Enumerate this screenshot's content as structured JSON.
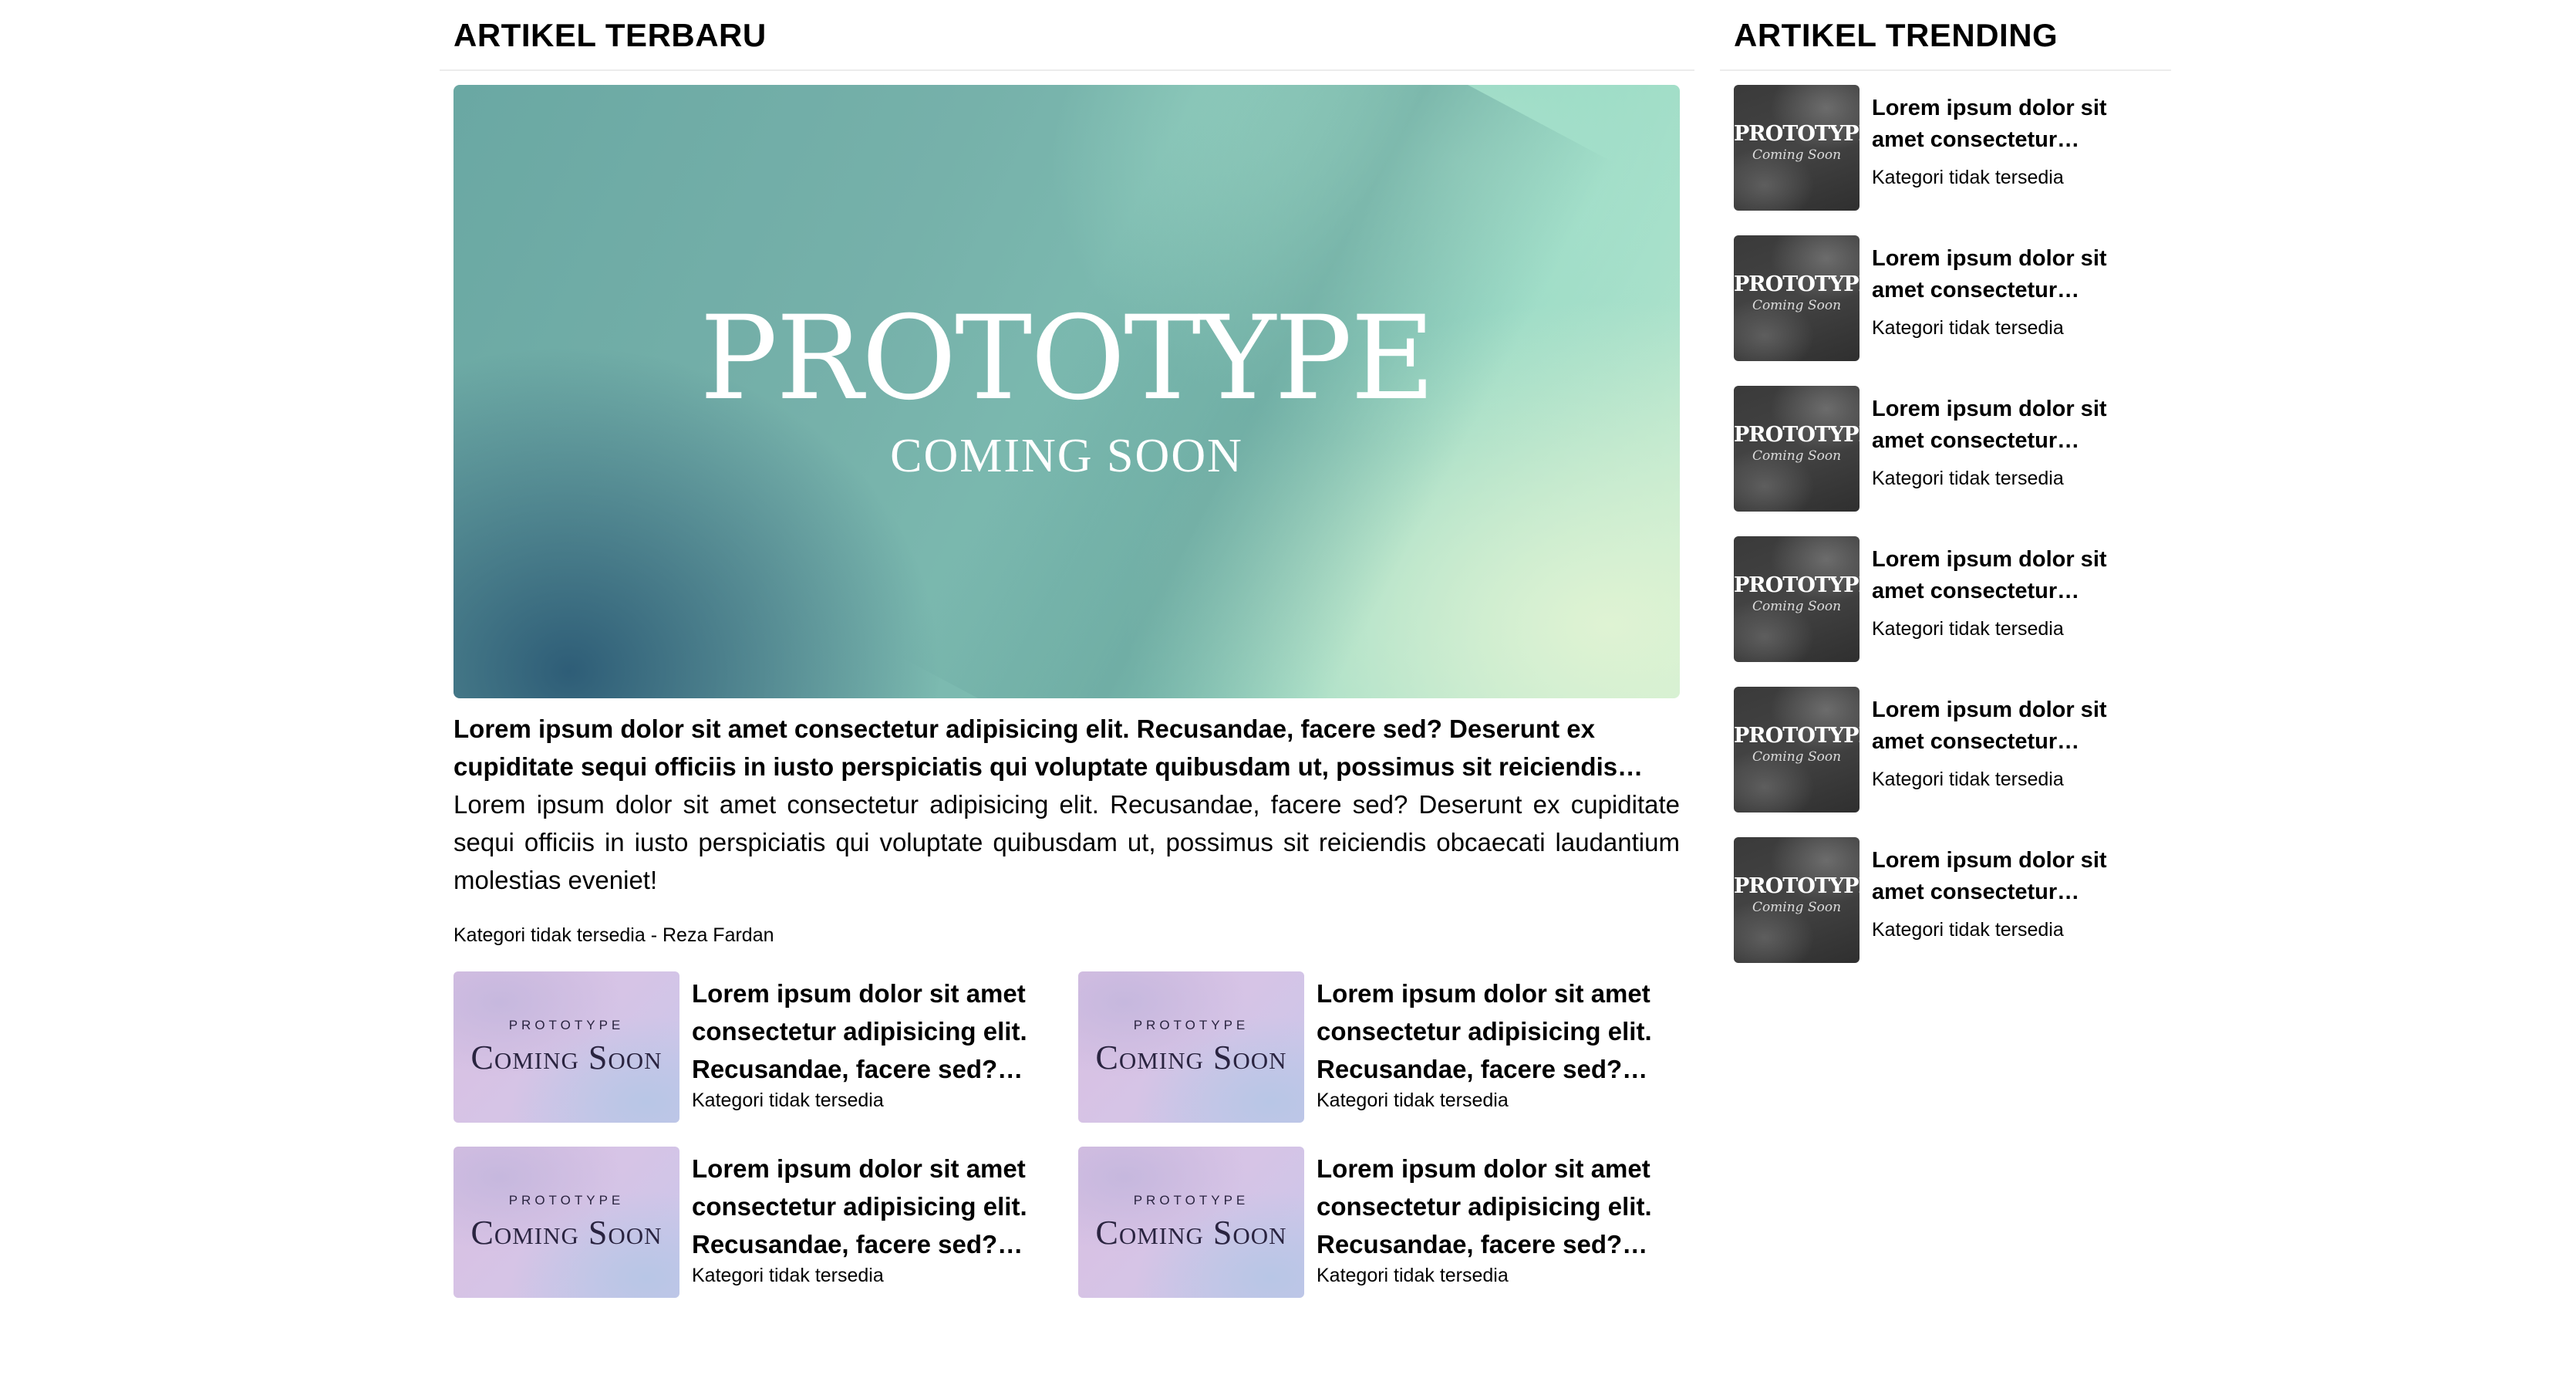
{
  "latest": {
    "section_title": "ARTIKEL TERBARU",
    "hero": {
      "image": {
        "title": "PROTOTYPE",
        "subtitle": "COMING SOON"
      },
      "title": "Lorem ipsum dolor sit amet consectetur adipisicing elit. Recusandae, facere sed? Deserunt ex cupiditate sequi officiis in iusto perspiciatis qui voluptate quibusdam ut, possimus sit reiciendis obcaecati laudantium molestias eveniet!",
      "excerpt": "Lorem ipsum dolor sit amet consectetur adipisicing elit. Recusandae, facere sed? Deserunt ex cupiditate sequi officiis in iusto perspiciatis qui voluptate quibusdam ut, possimus sit reiciendis obcaecati laudantium molestias eveniet!",
      "category": "Kategori tidak tersedia",
      "separator": "-",
      "author": "Reza Fardan"
    },
    "grid": [
      {
        "thumb_small": "PROTOTYPE",
        "thumb_big": "Coming Soon",
        "title": "Lorem ipsum dolor sit amet consectetur adipisicing elit. Recusandae, facere sed? Deserunt ex cupiditate",
        "category": "Kategori tidak tersedia"
      },
      {
        "thumb_small": "PROTOTYPE",
        "thumb_big": "Coming Soon",
        "title": "Lorem ipsum dolor sit amet consectetur adipisicing elit. Recusandae, facere sed? Deserunt ex cupiditate",
        "category": "Kategori tidak tersedia"
      },
      {
        "thumb_small": "PROTOTYPE",
        "thumb_big": "Coming Soon",
        "title": "Lorem ipsum dolor sit amet consectetur adipisicing elit. Recusandae, facere sed? Deserunt ex cupiditate",
        "category": "Kategori tidak tersedia"
      },
      {
        "thumb_small": "PROTOTYPE",
        "thumb_big": "Coming Soon",
        "title": "Lorem ipsum dolor sit amet consectetur adipisicing elit. Recusandae, facere sed? Deserunt ex cupiditate",
        "category": "Kategori tidak tersedia"
      }
    ]
  },
  "trending": {
    "section_title": "ARTIKEL TRENDING",
    "items": [
      {
        "thumb_big": "PROTOTYPE",
        "thumb_small": "Coming Soon",
        "title": "Lorem ipsum dolor sit amet consectetur adipisicing elit.",
        "category": "Kategori tidak tersedia"
      },
      {
        "thumb_big": "PROTOTYPE",
        "thumb_small": "Coming Soon",
        "title": "Lorem ipsum dolor sit amet consectetur adipisicing elit.",
        "category": "Kategori tidak tersedia"
      },
      {
        "thumb_big": "PROTOTYPE",
        "thumb_small": "Coming Soon",
        "title": "Lorem ipsum dolor sit amet consectetur adipisicing elit.",
        "category": "Kategori tidak tersedia"
      },
      {
        "thumb_big": "PROTOTYPE",
        "thumb_small": "Coming Soon",
        "title": "Lorem ipsum dolor sit amet consectetur adipisicing elit.",
        "category": "Kategori tidak tersedia"
      },
      {
        "thumb_big": "PROTOTYPE",
        "thumb_small": "Coming Soon",
        "title": "Lorem ipsum dolor sit amet consectetur adipisicing elit.",
        "category": "Kategori tidak tersedia"
      },
      {
        "thumb_big": "PROTOTYPE",
        "thumb_small": "Coming Soon",
        "title": "Lorem ipsum dolor sit amet consectetur adipisicing elit.",
        "category": "Kategori tidak tersedia"
      }
    ]
  }
}
